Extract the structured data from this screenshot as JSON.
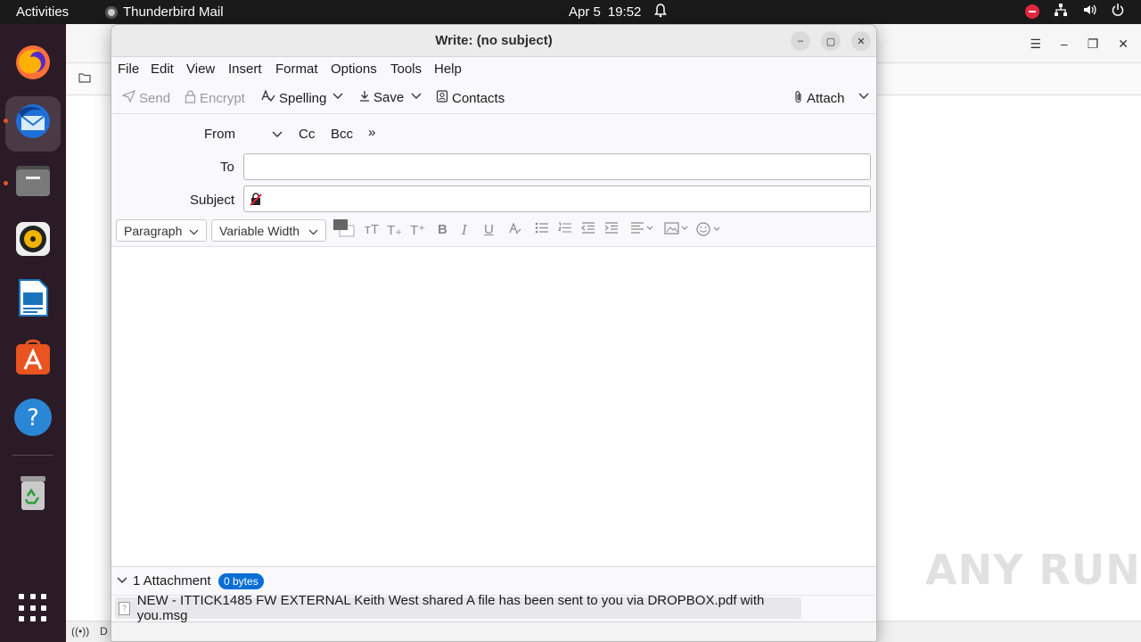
{
  "topbar": {
    "activities": "Activities",
    "app_name": "Thunderbird Mail",
    "date": "Apr 5",
    "time": "19:52"
  },
  "dock": {
    "apps": [
      "firefox-icon",
      "thunderbird-icon",
      "files-icon",
      "rhythmbox-icon",
      "libreoffice-writer-icon",
      "app-center-icon",
      "help-icon",
      "trash-icon",
      "show-apps-icon"
    ],
    "help_glyph": "?"
  },
  "background_window": {
    "status_text": "D"
  },
  "compose": {
    "title": "Write: (no subject)",
    "menu": [
      "File",
      "Edit",
      "View",
      "Insert",
      "Format",
      "Options",
      "Tools",
      "Help"
    ],
    "toolbar": {
      "send": "Send",
      "encrypt": "Encrypt",
      "spelling": "Spelling",
      "save": "Save",
      "contacts": "Contacts",
      "attach": "Attach"
    },
    "headers": {
      "from_label": "From",
      "cc": "Cc",
      "bcc": "Bcc",
      "to_label": "To",
      "to_value": "",
      "subject_label": "Subject",
      "subject_value": ""
    },
    "format": {
      "paragraph": "Paragraph",
      "font": "Variable Width"
    },
    "attachments": {
      "count_label": "1 Attachment",
      "size_badge": "0 bytes",
      "items": [
        "NEW - ITTICK1485 FW EXTERNAL Keith West shared A file has been sent to you via DROPBOX.pdf with you.msg"
      ]
    }
  },
  "watermark": "ANY RUN"
}
